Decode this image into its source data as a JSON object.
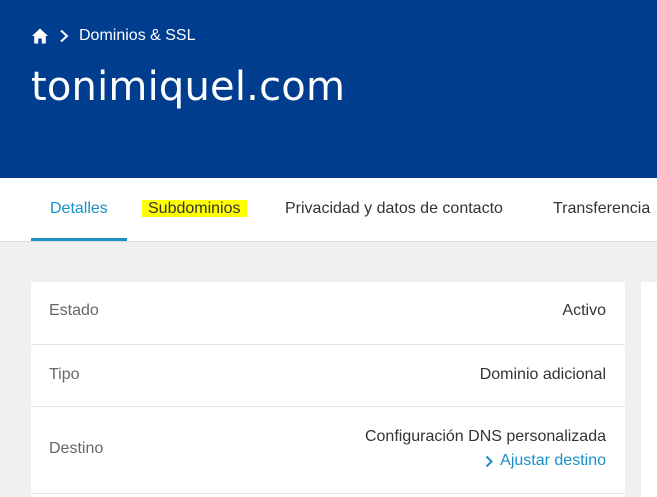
{
  "breadcrumb": {
    "home_icon": "home-icon",
    "separator_icon": "chevron-right-icon",
    "section": "Dominios & SSL"
  },
  "page": {
    "title": "tonimiquel.com"
  },
  "tabs": [
    {
      "label": "Detalles",
      "active": true
    },
    {
      "label": "Subdominios",
      "highlighted": true
    },
    {
      "label": "Privacidad y datos de contacto"
    },
    {
      "label": "Transferencia"
    }
  ],
  "details": {
    "rows": [
      {
        "label": "Estado",
        "value": "Activo"
      },
      {
        "label": "Tipo",
        "value": "Dominio adicional"
      },
      {
        "label": "Destino",
        "value": "Configuración DNS personalizada",
        "link": "Ajustar destino"
      }
    ]
  },
  "colors": {
    "header_bg": "#003d8f",
    "accent": "#1a8fc6",
    "highlight": "#ffff00"
  }
}
